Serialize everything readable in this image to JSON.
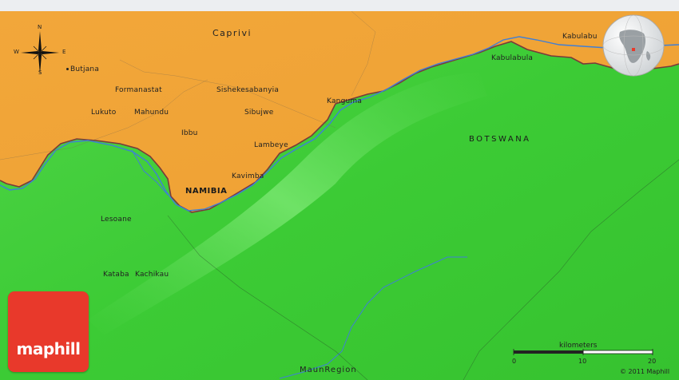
{
  "map": {
    "region_label": "Caprivi",
    "countries": {
      "namibia": "NAMIBIA",
      "botswana": "BOTSWANA"
    },
    "places": {
      "butjana": "Butjana",
      "formanastat": "Formanastat",
      "sishekesabanyia": "Sishekesabanyia",
      "lukuto": "Lukuto",
      "mahundu": "Mahundu",
      "sibujwe": "Sibujwe",
      "kanguma": "Kanguma",
      "ibbu": "Ibbu",
      "lambeye": "Lambeye",
      "kavimba": "Kavimba",
      "kabulabu_top": "Kabulabu",
      "kabulabula": "Kabulabula",
      "lesoane": "Lesoane",
      "kataba": "Kataba",
      "kachikau": "Kachikau",
      "maun_region": "MaunRegion"
    },
    "colors": {
      "land_namibia": "#f0a436",
      "land_botswana": "#3fcc3a",
      "border": "#7a3a3a",
      "river": "#3f7fd6",
      "logo_red": "#e8392b"
    }
  },
  "compass": {
    "north": "N",
    "south": "S",
    "east": "E",
    "west": "W"
  },
  "scale": {
    "title": "kilometers",
    "ticks": [
      "0",
      "10",
      "20"
    ]
  },
  "logo": {
    "text": "maphill"
  },
  "copyright": "© 2011 Maphill",
  "globe": {
    "icon": "globe-locator-icon"
  }
}
